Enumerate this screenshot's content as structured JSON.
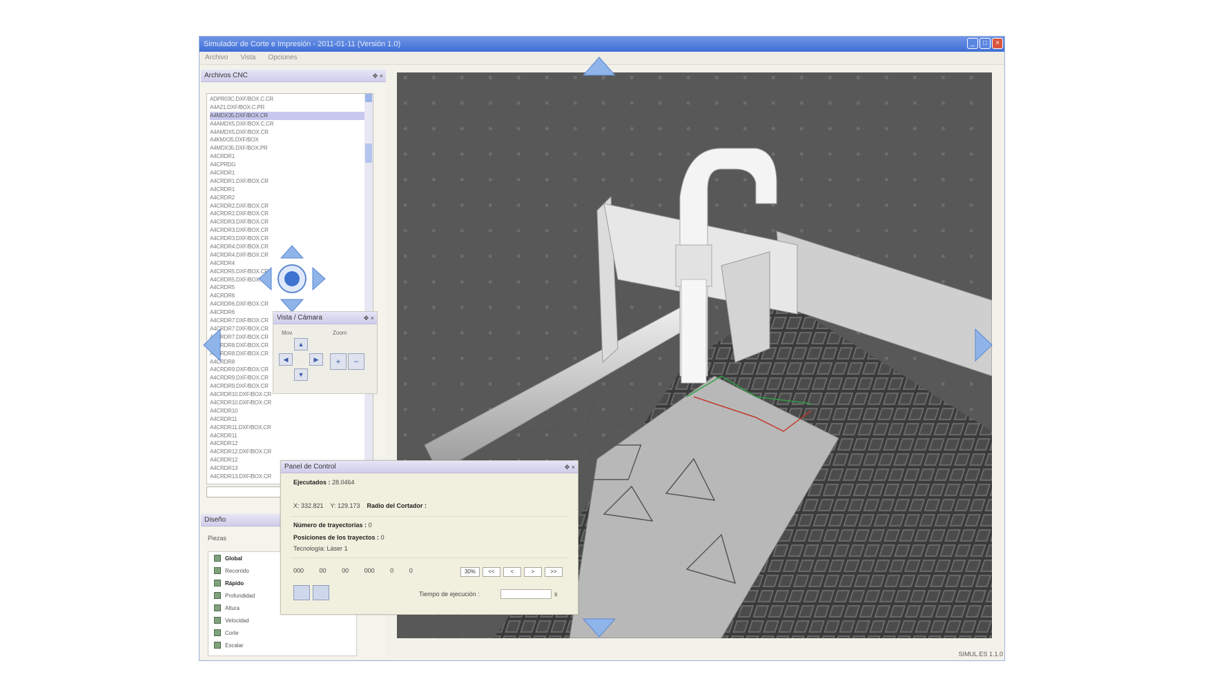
{
  "window": {
    "title": "Simulador de Corte e Impresión - 2011-01-11 (Versión 1.0)"
  },
  "menu": [
    "Archivo",
    "Vista",
    "Opciones"
  ],
  "file_panel": {
    "title": "Archivos CNC",
    "items": [
      "ADPR03C.DXF/BOX.C.CR",
      "A4A21.DXF/BOX.C.PR",
      "A4MDX35.DXF/BOX.CR",
      "A4AMDX5.DXF/BOX.C.CR",
      "A4AMDX5.DXF/BOX.CR",
      "A4KMX35.DXF/BOX",
      "A4MDX35.DXF/BOX.PR",
      "A4CRDR1",
      "A4CPRDG",
      "A4CRDR1",
      "A4CRDR1.DXF/BOX.CR",
      "A4CRDR1",
      "A4CRDR2",
      "A4CRDR2.DXF/BOX.CR",
      "A4CRDR2.DXF/BOX.CR",
      "A4CRDR3.DXF/BOX.CR",
      "A4CRDR3.DXF/BOX.CR",
      "A4CRDR3.DXF/BOX.CR",
      "A4CRDR4.DXF/BOX.CR",
      "A4CRDR4.DXF/BOX.CR",
      "A4CRDR4",
      "A4CRDR5.DXF/BOX.CR",
      "A4CRDR5.DXF/BOX.CR",
      "A4CRDR5",
      "A4CRDR6",
      "A4CRDR6.DXF/BOX.CR",
      "A4CRDR6",
      "A4CRDR7.DXF/BOX.CR",
      "A4CRDR7.DXF/BOX.CR",
      "A4CRDR7.DXF/BOX.CR",
      "A4CRDR8.DXF/BOX.CR",
      "A4CRDR8.DXF/BOX.CR",
      "A4CRDR8",
      "A4CRDR9.DXF/BOX.CR",
      "A4CRDR9.DXF/BOX.CR",
      "A4CRDR9.DXF/BOX.CR",
      "A4CRDR10.DXF/BOX.CR",
      "A4CRDR10.DXF/BOX.CR",
      "A4CRDR10",
      "A4CRDR11",
      "A4CRDR11.DXF/BOX.CR",
      "A4CRDR11",
      "A4CRDR12",
      "A4CRDR12.DXF/BOX.CR",
      "A4CRDR12",
      "A4CRDR13",
      "A4CRDR13.DXF/BOX.CR"
    ],
    "selected_index": 2,
    "scroll_button": "▸"
  },
  "view_panel": {
    "title": "Vista / Cámara",
    "move_label": "Mov.",
    "zoom_label": "Zoom",
    "up": "▲",
    "down": "▼",
    "left": "◀",
    "right": "▶",
    "zoom_in": "+",
    "zoom_out": "−"
  },
  "tree_panel": {
    "title": "Diseño",
    "subtitle": "Piezas",
    "items": [
      {
        "label": "Global",
        "bold": true
      },
      {
        "label": "Recorrido",
        "bold": false
      },
      {
        "label": "Rápido",
        "bold": true
      },
      {
        "label": "Profundidad",
        "bold": false
      },
      {
        "label": "Altura",
        "bold": false
      },
      {
        "label": "Velocidad",
        "bold": false
      },
      {
        "label": "Corte",
        "bold": false
      },
      {
        "label": "Escalar",
        "bold": false
      }
    ]
  },
  "control_panel": {
    "title": "Panel de Control",
    "execution_label": "Ejecutados :",
    "execution_value": "28.0464",
    "x_label": "X:",
    "x_value": "332.821",
    "y_label": "Y:",
    "y_value": "129.173",
    "radius_label": "Radio del Cortador :",
    "num_tools_label": "Número de trayectorias :",
    "num_tools_value": "0",
    "tool_positions_label": "Posiciones de los trayectos :",
    "tool_positions_value": "0",
    "tech_label": "Tecnología: Láser",
    "tech_value": "1",
    "steps": [
      "000",
      "00",
      "00",
      "000",
      "0",
      "0"
    ],
    "zoom_value": "30%",
    "nav_buttons": [
      "<<",
      "<",
      ">",
      ">>"
    ],
    "time_label": "Tiempo de ejecución :",
    "time_unit": "s"
  },
  "status_bar": {
    "text": "SIMUL.ES 1.1.0"
  }
}
